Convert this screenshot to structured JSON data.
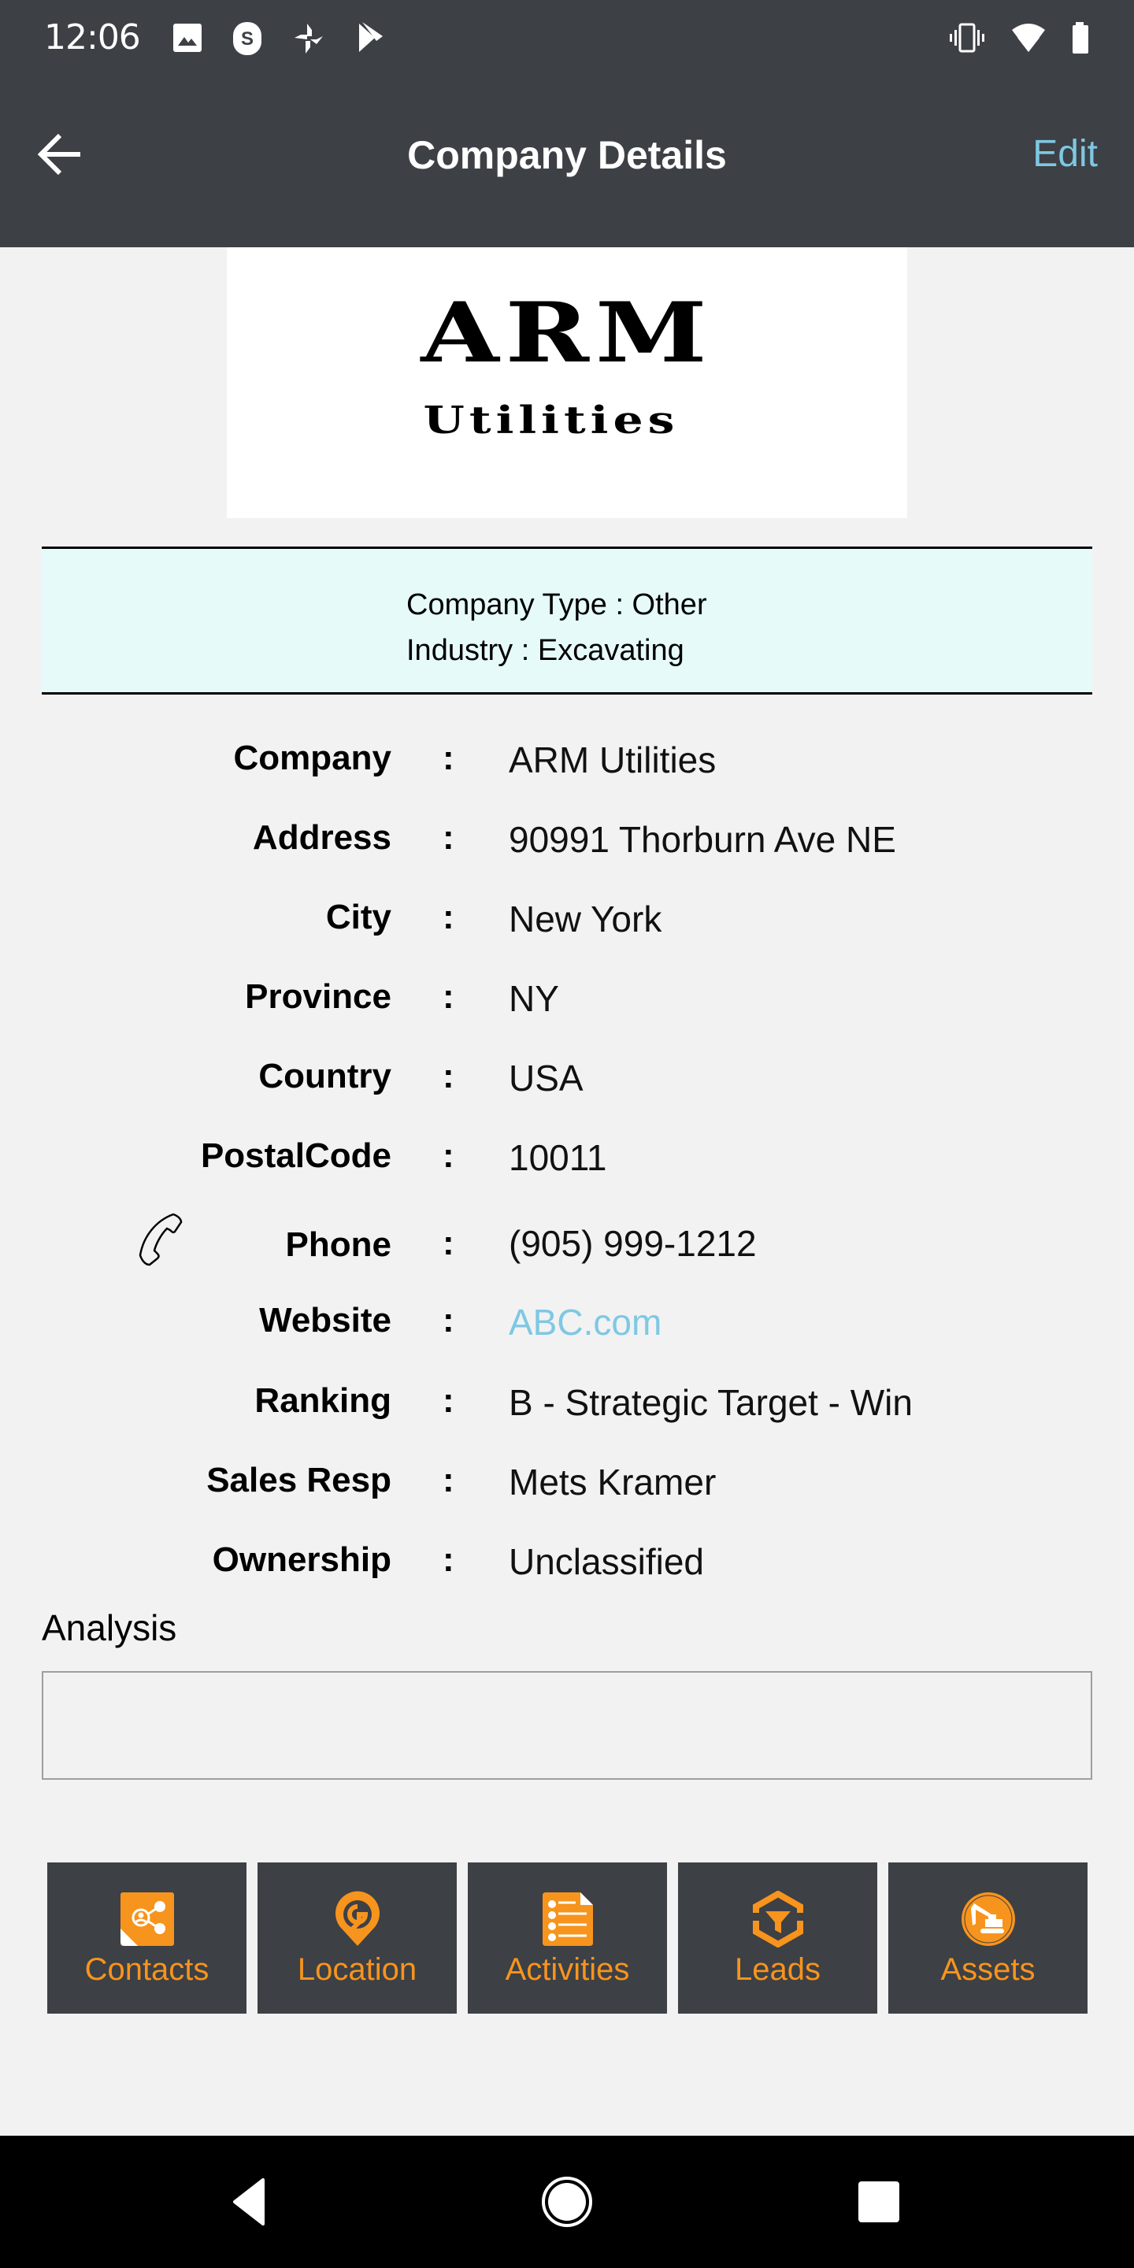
{
  "status_bar": {
    "time": "12:06",
    "left_icons": [
      "gallery-icon",
      "skype-icon",
      "pinwheel-icon",
      "play-store-icon"
    ],
    "right_icons": [
      "vibrate-icon",
      "wifi-icon",
      "battery-icon"
    ]
  },
  "app_bar": {
    "title": "Company Details",
    "back_icon": "arrow-left-icon",
    "edit_label": "Edit"
  },
  "logo": {
    "line1": "ARM",
    "line2": "Utilities"
  },
  "info_panel": {
    "company_type": "Company Type : Other",
    "industry": "Industry : Excavating"
  },
  "details": {
    "separator": ":",
    "rows": [
      {
        "label": "Company",
        "value": "ARM Utilities"
      },
      {
        "label": "Address",
        "value": "90991 Thorburn Ave NE"
      },
      {
        "label": "City",
        "value": "New York"
      },
      {
        "label": "Province",
        "value": "NY"
      },
      {
        "label": "Country",
        "value": "USA"
      },
      {
        "label": "PostalCode",
        "value": "10011"
      },
      {
        "label": "Phone",
        "value": "(905) 999-1212",
        "icon": "phone-icon"
      },
      {
        "label": "Website",
        "value": "ABC.com",
        "link": true
      },
      {
        "label": "Ranking",
        "value": "B - Strategic Target - Win"
      },
      {
        "label": "Sales Resp",
        "value": "Mets Kramer"
      },
      {
        "label": "Ownership",
        "value": "Unclassified"
      }
    ]
  },
  "analysis": {
    "label": "Analysis",
    "value": ""
  },
  "actions": [
    {
      "label": "Contacts",
      "icon": "contacts-share-icon"
    },
    {
      "label": "Location",
      "icon": "location-pin-icon"
    },
    {
      "label": "Activities",
      "icon": "checklist-icon"
    },
    {
      "label": "Leads",
      "icon": "funnel-icon"
    },
    {
      "label": "Assets",
      "icon": "excavator-icon"
    }
  ],
  "colors": {
    "bar_dark": "#3d4045",
    "accent_orange": "#f7941d",
    "link_blue": "#7ec8e3",
    "info_panel_bg": "#e6fafa",
    "page_bg": "#f2f2f2"
  },
  "nav_bar": {
    "buttons": [
      "back-triangle-icon",
      "home-circle-icon",
      "recents-square-icon"
    ]
  }
}
